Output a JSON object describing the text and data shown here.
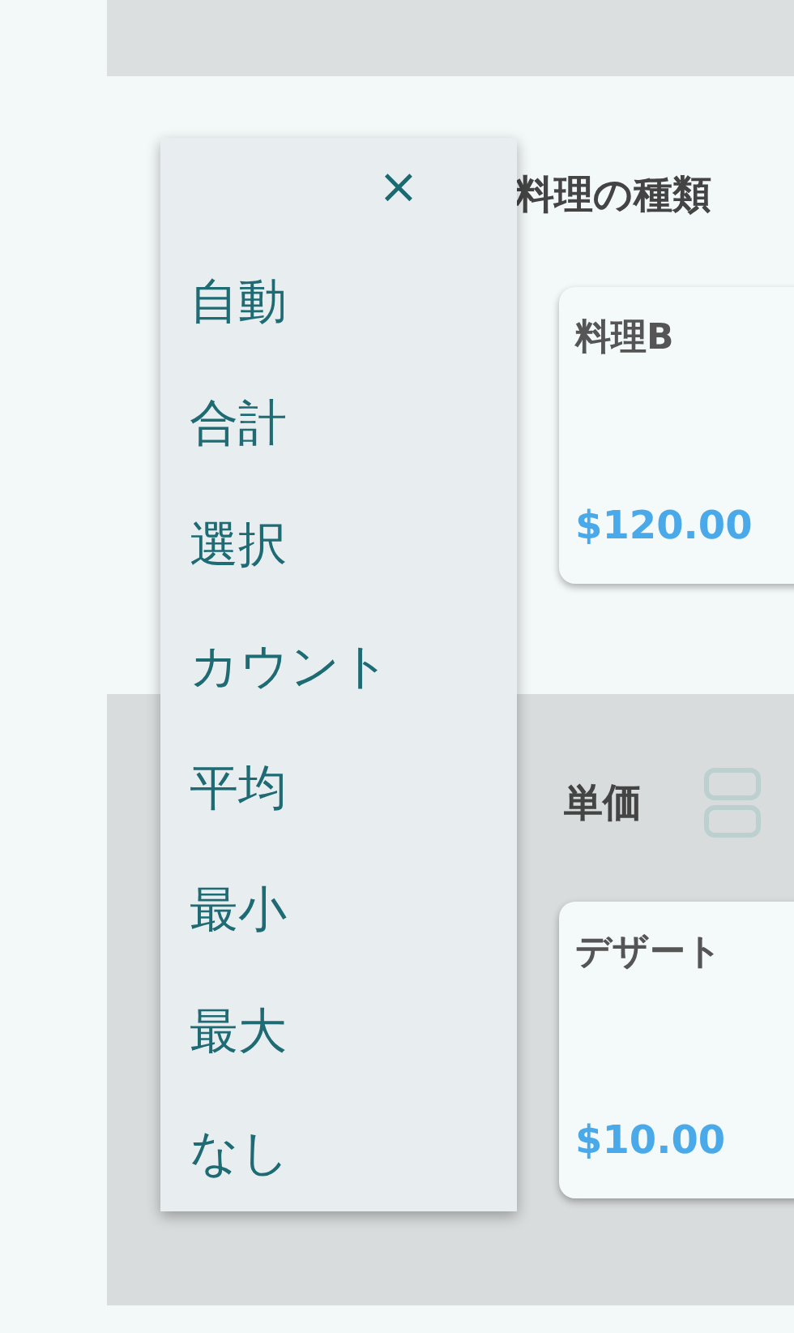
{
  "sections": [
    {
      "heading": "料理の種類",
      "cards": [
        {
          "name": "料理B",
          "price": "$120.00"
        }
      ]
    },
    {
      "heading": "単価",
      "cards": [
        {
          "name": "デザート",
          "price": "$10.00"
        }
      ]
    }
  ],
  "menu": {
    "close": "×",
    "items": [
      {
        "label": "自動"
      },
      {
        "label": "合計"
      },
      {
        "label": "選択"
      },
      {
        "label": "カウント"
      },
      {
        "label": "平均"
      },
      {
        "label": "最小"
      },
      {
        "label": "最大"
      },
      {
        "label": "なし"
      }
    ]
  }
}
